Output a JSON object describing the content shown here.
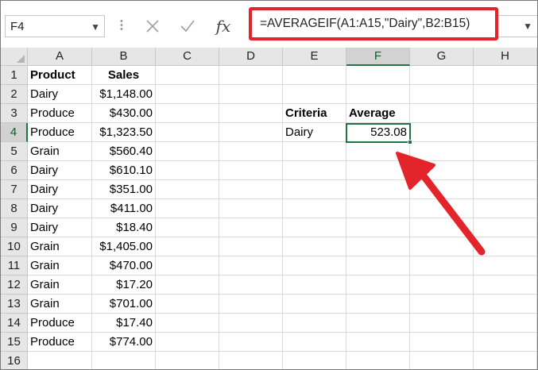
{
  "name_box": {
    "value": "F4"
  },
  "formula_bar": {
    "cancel_icon": "close-x-icon",
    "enter_icon": "checkmark-icon",
    "fx_label": "fx",
    "formula": "=AVERAGEIF(A1:A15,\"Dairy\",B2:B15)"
  },
  "columns": [
    "A",
    "B",
    "C",
    "D",
    "E",
    "F",
    "G",
    "H"
  ],
  "rows": [
    "1",
    "2",
    "3",
    "4",
    "5",
    "6",
    "7",
    "8",
    "9",
    "10",
    "11",
    "12",
    "13",
    "14",
    "15",
    "16"
  ],
  "selected": {
    "column": "F",
    "row": "4"
  },
  "cells": {
    "A1": "Product",
    "B1": "Sales",
    "A2": "Dairy",
    "B2": "$1,148.00",
    "A3": "Produce",
    "B3": "$430.00",
    "A4": "Produce",
    "B4": "$1,323.50",
    "A5": "Grain",
    "B5": "$560.40",
    "A6": "Dairy",
    "B6": "$610.10",
    "A7": "Dairy",
    "B7": "$351.00",
    "A8": "Dairy",
    "B8": "$411.00",
    "A9": "Dairy",
    "B9": "$18.40",
    "A10": "Grain",
    "B10": "$1,405.00",
    "A11": "Grain",
    "B11": "$470.00",
    "A12": "Grain",
    "B12": "$17.20",
    "A13": "Grain",
    "B13": "$701.00",
    "A14": "Produce",
    "B14": "$17.40",
    "A15": "Produce",
    "B15": "$774.00",
    "E3": "Criteria",
    "F3": "Average",
    "E4": "Dairy",
    "F4": "523.08"
  },
  "colors": {
    "highlight_red": "#e3242b",
    "selection_green": "#217346"
  }
}
